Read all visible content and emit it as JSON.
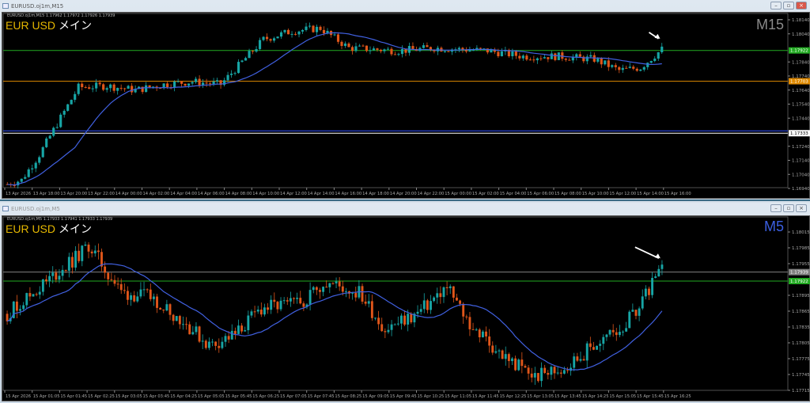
{
  "top": {
    "title": "EURUSD.oj1m,M15",
    "ohlc": "EURUSD.oj1m,M15  1.17962 1.17972 1.17926 1.17939",
    "symbol": "EUR USD",
    "symbol_jp": "メイン",
    "timeframe": "M15",
    "price_labels": [
      "1.18140",
      "1.18040",
      "1.17840",
      "1.17740",
      "1.17640",
      "1.17540",
      "1.17440",
      "1.17240",
      "1.17140",
      "1.17040",
      "1.16940"
    ],
    "levels": [
      {
        "price": 1.17922,
        "label": "1.17922",
        "color": "#22aa22"
      },
      {
        "price": 1.17703,
        "label": "1.17703",
        "color": "#e08a00"
      },
      {
        "price": 1.1735,
        "label": "",
        "color": "#3050ff"
      },
      {
        "price": 1.17333,
        "label": "1.17333",
        "color": "#ffffff"
      }
    ],
    "time_labels": [
      "13 Apr 2026",
      "13 Apr 18:00",
      "13 Apr 20:00",
      "13 Apr 22:00",
      "14 Apr 00:00",
      "14 Apr 02:00",
      "14 Apr 04:00",
      "14 Apr 06:00",
      "14 Apr 08:00",
      "14 Apr 10:00",
      "14 Apr 12:00",
      "14 Apr 14:00",
      "14 Apr 16:00",
      "14 Apr 18:00",
      "14 Apr 20:00",
      "14 Apr 22:00",
      "15 Apr 00:00",
      "15 Apr 02:00",
      "15 Apr 04:00",
      "15 Apr 06:00",
      "15 Apr 08:00",
      "15 Apr 10:00",
      "15 Apr 12:00",
      "15 Apr 14:00",
      "15 Apr 16:00"
    ]
  },
  "bottom": {
    "title": "EURUSD.oj1m,M5",
    "ohlc": "EURUSD.oj1m,M5  1.17933 1.17941 1.17933 1.17939",
    "symbol": "EUR USD",
    "symbol_jp": "メイン",
    "timeframe": "M5",
    "price_labels": [
      "1.18015",
      "1.17985",
      "1.17955",
      "1.17895",
      "1.17865",
      "1.17835",
      "1.17805",
      "1.17775",
      "1.17745",
      "1.17715"
    ],
    "levels": [
      {
        "price": 1.17939,
        "label": "1.17939",
        "color": "#808080"
      },
      {
        "price": 1.17922,
        "label": "1.17922",
        "color": "#22aa22"
      }
    ],
    "time_labels": [
      "15 Apr 2026",
      "15 Apr 01:05",
      "15 Apr 01:45",
      "15 Apr 02:25",
      "15 Apr 03:05",
      "15 Apr 03:45",
      "15 Apr 04:25",
      "15 Apr 05:05",
      "15 Apr 05:45",
      "15 Apr 06:25",
      "15 Apr 07:05",
      "15 Apr 07:45",
      "15 Apr 08:25",
      "15 Apr 09:05",
      "15 Apr 09:45",
      "15 Apr 10:25",
      "15 Apr 11:05",
      "15 Apr 11:45",
      "15 Apr 12:25",
      "15 Apr 13:05",
      "15 Apr 13:45",
      "15 Apr 14:25",
      "15 Apr 15:05",
      "15 Apr 15:45",
      "15 Apr 16:25"
    ]
  },
  "colors": {
    "bull": "#17a5a5",
    "bear": "#e0561a",
    "ma": "#4060e0"
  },
  "chart_data": [
    {
      "type": "candlestick",
      "name": "M15",
      "price_range": [
        1.169,
        1.1816
      ],
      "path": [
        [
          0,
          1.1697
        ],
        [
          4,
          1.17
        ],
        [
          9,
          1.1718
        ],
        [
          14,
          1.174
        ],
        [
          20,
          1.1766
        ],
        [
          28,
          1.1767
        ],
        [
          36,
          1.1764
        ],
        [
          44,
          1.1768
        ],
        [
          52,
          1.177
        ],
        [
          60,
          1.1768
        ],
        [
          66,
          1.1784
        ],
        [
          72,
          1.18
        ],
        [
          80,
          1.1806
        ],
        [
          88,
          1.1808
        ],
        [
          96,
          1.1794
        ],
        [
          110,
          1.1792
        ],
        [
          120,
          1.1794
        ],
        [
          135,
          1.1792
        ],
        [
          145,
          1.1788
        ],
        [
          155,
          1.1788
        ],
        [
          165,
          1.1786
        ],
        [
          172,
          1.1778
        ],
        [
          178,
          1.178
        ],
        [
          184,
          1.1793
        ]
      ]
    },
    {
      "type": "candlestick",
      "name": "M5",
      "price_range": [
        1.177,
        1.1803
      ],
      "path": [
        [
          0,
          1.1786
        ],
        [
          10,
          1.1791
        ],
        [
          22,
          1.1797
        ],
        [
          25,
          1.1799
        ],
        [
          35,
          1.179
        ],
        [
          45,
          1.1789
        ],
        [
          55,
          1.1784
        ],
        [
          62,
          1.178
        ],
        [
          70,
          1.1782
        ],
        [
          78,
          1.1787
        ],
        [
          90,
          1.1788
        ],
        [
          97,
          1.1792
        ],
        [
          108,
          1.179
        ],
        [
          116,
          1.1783
        ],
        [
          126,
          1.1786
        ],
        [
          135,
          1.1791
        ],
        [
          142,
          1.1784
        ],
        [
          152,
          1.1778
        ],
        [
          162,
          1.1774
        ],
        [
          172,
          1.1776
        ],
        [
          180,
          1.178
        ],
        [
          190,
          1.1784
        ],
        [
          196,
          1.179
        ],
        [
          201,
          1.1794
        ]
      ]
    }
  ]
}
